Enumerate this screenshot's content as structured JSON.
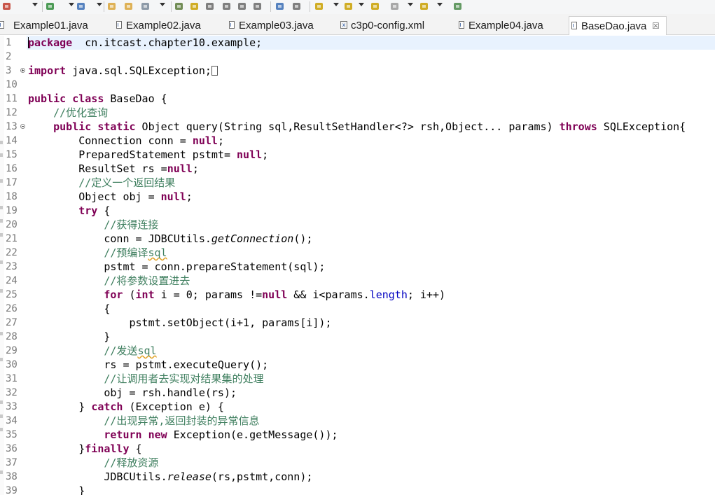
{
  "toolbar": {
    "icons": [
      "debug-run-icon",
      "run-icon",
      "new-server-icon",
      "open-folder-icon",
      "open-project-icon",
      "magic-wand-icon",
      "pin-icon",
      "mark-occurrences-icon",
      "word-wrap-icon",
      "block-select-icon",
      "show-whitespace-icon",
      "pilcrow-icon",
      "globe-icon",
      "search-icon",
      "next-annotation-icon",
      "prev-annotation-icon",
      "back-icon",
      "forward-icon",
      "last-edit-icon",
      "maximize-icon"
    ]
  },
  "tabs": [
    {
      "label": "Example01.java",
      "type": "java",
      "active": false
    },
    {
      "label": "Example02.java",
      "type": "java",
      "active": false
    },
    {
      "label": "Example03.java",
      "type": "java",
      "active": false
    },
    {
      "label": "c3p0-config.xml",
      "type": "xml",
      "active": false
    },
    {
      "label": "Example04.java",
      "type": "java",
      "active": false
    },
    {
      "label": "BaseDao.java",
      "type": "java",
      "active": true,
      "close": "☒"
    }
  ],
  "editor": {
    "current_line": 1,
    "lines": [
      {
        "n": "1",
        "fold": "",
        "segs": [
          [
            "kw",
            "package"
          ],
          [
            "",
            "  cn.itcast.chapter10.example;"
          ]
        ]
      },
      {
        "n": "2",
        "fold": "",
        "segs": []
      },
      {
        "n": "3",
        "fold": "plus",
        "segs": [
          [
            "kw",
            "import"
          ],
          [
            "",
            " java.sql.SQLException;"
          ],
          [
            "box",
            ""
          ]
        ]
      },
      {
        "n": "10",
        "fold": "",
        "segs": []
      },
      {
        "n": "11",
        "fold": "",
        "segs": [
          [
            "kw",
            "public"
          ],
          [
            "",
            " "
          ],
          [
            "kw",
            "class"
          ],
          [
            "",
            " BaseDao {"
          ]
        ]
      },
      {
        "n": "12",
        "fold": "",
        "segs": [
          [
            "",
            "    "
          ],
          [
            "cm",
            "//优化查询"
          ]
        ]
      },
      {
        "n": "13",
        "fold": "minus",
        "segs": [
          [
            "",
            "    "
          ],
          [
            "kw",
            "public"
          ],
          [
            "",
            " "
          ],
          [
            "kw",
            "static"
          ],
          [
            "",
            " Object query(String sql,ResultSetHandler<?> rsh,Object... params) "
          ],
          [
            "kw",
            "throws"
          ],
          [
            "",
            " SQLException{"
          ]
        ]
      },
      {
        "n": "14",
        "fold": "",
        "segs": [
          [
            "",
            "        Connection conn = "
          ],
          [
            "kw",
            "null"
          ],
          [
            "",
            ";"
          ]
        ]
      },
      {
        "n": "15",
        "fold": "",
        "segs": [
          [
            "",
            "        PreparedStatement pstmt= "
          ],
          [
            "kw",
            "null"
          ],
          [
            "",
            ";"
          ]
        ]
      },
      {
        "n": "16",
        "fold": "",
        "segs": [
          [
            "",
            "        ResultSet rs ="
          ],
          [
            "kw",
            "null"
          ],
          [
            "",
            ";"
          ]
        ]
      },
      {
        "n": "17",
        "fold": "",
        "segs": [
          [
            "",
            "        "
          ],
          [
            "cm",
            "//定义一个返回结果"
          ]
        ]
      },
      {
        "n": "18",
        "fold": "",
        "segs": [
          [
            "",
            "        Object obj = "
          ],
          [
            "kw",
            "null"
          ],
          [
            "",
            ";"
          ]
        ]
      },
      {
        "n": "19",
        "fold": "",
        "segs": [
          [
            "",
            "        "
          ],
          [
            "kw",
            "try"
          ],
          [
            "",
            " {"
          ]
        ]
      },
      {
        "n": "20",
        "fold": "",
        "segs": [
          [
            "",
            "            "
          ],
          [
            "cm",
            "//获得连接"
          ]
        ]
      },
      {
        "n": "21",
        "fold": "",
        "segs": [
          [
            "",
            "            conn = JDBCUtils."
          ],
          [
            "it",
            "getConnection"
          ],
          [
            "",
            "();"
          ]
        ]
      },
      {
        "n": "22",
        "fold": "",
        "segs": [
          [
            "",
            "            "
          ],
          [
            "cm",
            "//预编译"
          ],
          [
            "cmsq",
            "sql"
          ]
        ]
      },
      {
        "n": "23",
        "fold": "",
        "segs": [
          [
            "",
            "            pstmt = conn.prepareStatement(sql);"
          ]
        ]
      },
      {
        "n": "24",
        "fold": "",
        "segs": [
          [
            "",
            "            "
          ],
          [
            "cm",
            "//将参数设置进去"
          ]
        ]
      },
      {
        "n": "25",
        "fold": "",
        "segs": [
          [
            "",
            "            "
          ],
          [
            "kw",
            "for"
          ],
          [
            "",
            " ("
          ],
          [
            "kw",
            "int"
          ],
          [
            "",
            " i = 0; params !="
          ],
          [
            "kw",
            "null"
          ],
          [
            "",
            " && i<params."
          ],
          [
            "fd",
            "length"
          ],
          [
            "",
            "; i++)"
          ]
        ]
      },
      {
        "n": "26",
        "fold": "",
        "segs": [
          [
            "",
            "            {"
          ]
        ]
      },
      {
        "n": "27",
        "fold": "",
        "segs": [
          [
            "",
            "                pstmt.setObject(i+1, params[i]);"
          ]
        ]
      },
      {
        "n": "28",
        "fold": "",
        "segs": [
          [
            "",
            "            }"
          ]
        ]
      },
      {
        "n": "29",
        "fold": "",
        "segs": [
          [
            "",
            "            "
          ],
          [
            "cm",
            "//发送"
          ],
          [
            "cmsq",
            "sql"
          ]
        ]
      },
      {
        "n": "30",
        "fold": "",
        "segs": [
          [
            "",
            "            rs = pstmt.executeQuery();"
          ]
        ]
      },
      {
        "n": "31",
        "fold": "",
        "segs": [
          [
            "",
            "            "
          ],
          [
            "cm",
            "//让调用者去实现对结果集的处理"
          ]
        ]
      },
      {
        "n": "32",
        "fold": "",
        "segs": [
          [
            "",
            "            obj = rsh.handle(rs);"
          ]
        ]
      },
      {
        "n": "33",
        "fold": "",
        "segs": [
          [
            "",
            "        } "
          ],
          [
            "kw",
            "catch"
          ],
          [
            "",
            " (Exception e) {"
          ]
        ]
      },
      {
        "n": "34",
        "fold": "",
        "segs": [
          [
            "",
            "            "
          ],
          [
            "cm",
            "//出现异常,返回封装的异常信息"
          ]
        ]
      },
      {
        "n": "35",
        "fold": "",
        "segs": [
          [
            "",
            "            "
          ],
          [
            "kw",
            "return"
          ],
          [
            "",
            " "
          ],
          [
            "kw",
            "new"
          ],
          [
            "",
            " Exception(e.getMessage());"
          ]
        ]
      },
      {
        "n": "36",
        "fold": "",
        "segs": [
          [
            "",
            "        }"
          ],
          [
            "kw",
            "finally"
          ],
          [
            "",
            " {"
          ]
        ]
      },
      {
        "n": "37",
        "fold": "",
        "segs": [
          [
            "",
            "            "
          ],
          [
            "cm",
            "//释放资源"
          ]
        ]
      },
      {
        "n": "38",
        "fold": "",
        "segs": [
          [
            "",
            "            JDBCUtils."
          ],
          [
            "it",
            "release"
          ],
          [
            "",
            "(rs,pstmt,conn);"
          ]
        ]
      },
      {
        "n": "39",
        "fold": "",
        "segs": [
          [
            "",
            "        }"
          ]
        ]
      }
    ]
  }
}
